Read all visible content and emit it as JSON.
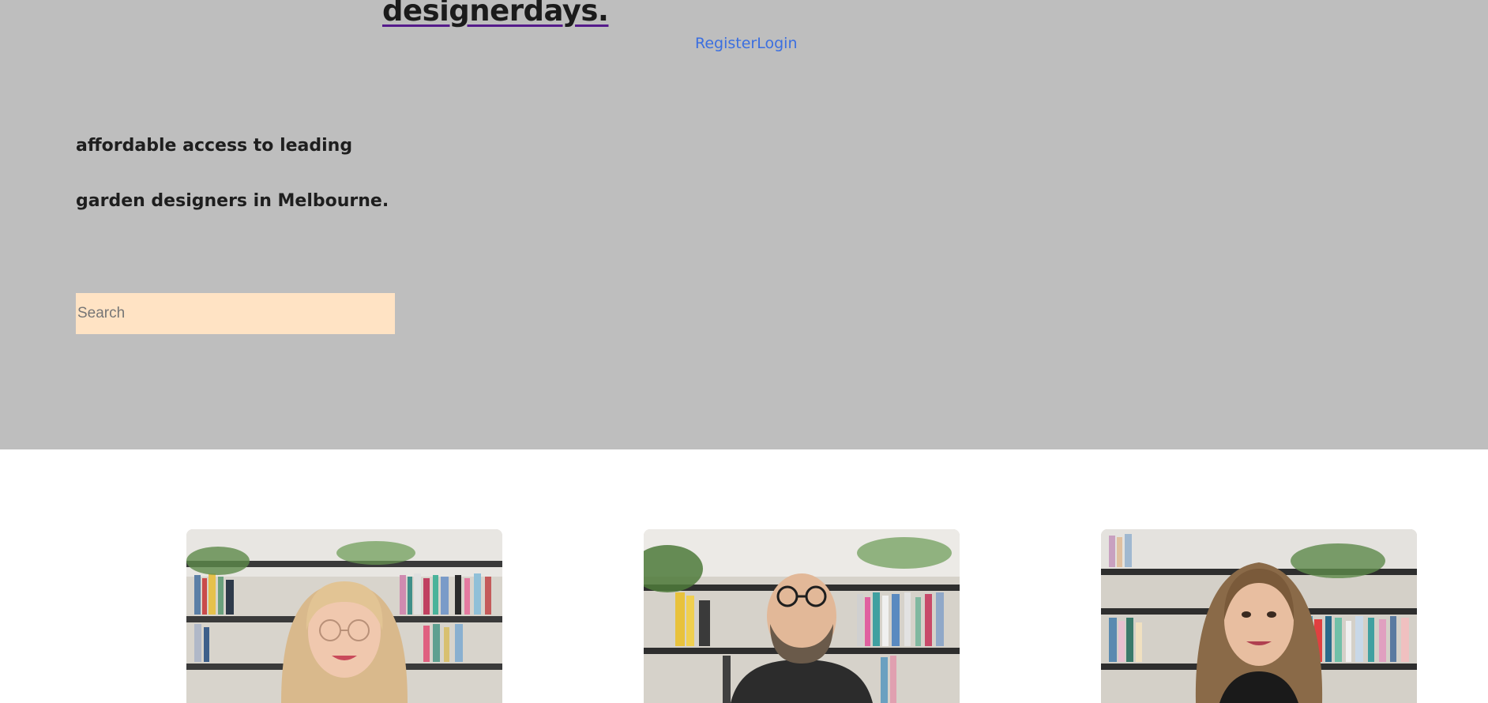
{
  "header": {
    "brand": "designerdays.",
    "nav": {
      "register_label": "Register",
      "login_label": "Login"
    }
  },
  "hero": {
    "tagline_line1": "affordable access to leading",
    "tagline_line2": "garden designers in Melbourne."
  },
  "search": {
    "placeholder": "Search",
    "value": ""
  },
  "designers": [
    {
      "photo": "woman-glasses-blonde"
    },
    {
      "photo": "man-glasses-beard"
    },
    {
      "photo": "woman-brown-hair"
    }
  ],
  "colors": {
    "hero_bg": "#bebebe",
    "link": "#3b6fe0",
    "brand_underline": "#551a8b",
    "search_bg": "#ffe3c4"
  }
}
